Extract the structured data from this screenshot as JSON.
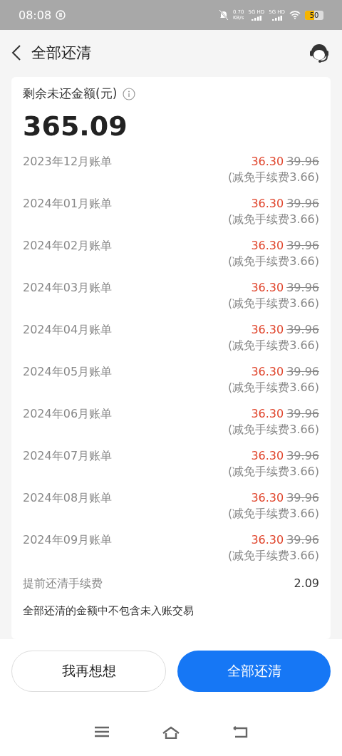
{
  "status_bar": {
    "time": "08:08",
    "speed": "0.70",
    "speed_unit": "KB/s",
    "networks": [
      "5G HD",
      "5G HD"
    ],
    "battery": "50"
  },
  "header": {
    "title": "全部还清"
  },
  "summary": {
    "label": "剩余未还金额(元)",
    "amount": "365.09"
  },
  "bills": [
    {
      "month": "2023年12月账单",
      "amount": "36.30",
      "original": "39.96",
      "note": "(减免手续费3.66)"
    },
    {
      "month": "2024年01月账单",
      "amount": "36.30",
      "original": "39.96",
      "note": "(减免手续费3.66)"
    },
    {
      "month": "2024年02月账单",
      "amount": "36.30",
      "original": "39.96",
      "note": "(减免手续费3.66)"
    },
    {
      "month": "2024年03月账单",
      "amount": "36.30",
      "original": "39.96",
      "note": "(减免手续费3.66)"
    },
    {
      "month": "2024年04月账单",
      "amount": "36.30",
      "original": "39.96",
      "note": "(减免手续费3.66)"
    },
    {
      "month": "2024年05月账单",
      "amount": "36.30",
      "original": "39.96",
      "note": "(减免手续费3.66)"
    },
    {
      "month": "2024年06月账单",
      "amount": "36.30",
      "original": "39.96",
      "note": "(减免手续费3.66)"
    },
    {
      "month": "2024年07月账单",
      "amount": "36.30",
      "original": "39.96",
      "note": "(减免手续费3.66)"
    },
    {
      "month": "2024年08月账单",
      "amount": "36.30",
      "original": "39.96",
      "note": "(减免手续费3.66)"
    },
    {
      "month": "2024年09月账单",
      "amount": "36.30",
      "original": "39.96",
      "note": "(减免手续费3.66)"
    }
  ],
  "fee": {
    "label": "提前还清手续费",
    "value": "2.09"
  },
  "notice": "全部还清的金额中不包含未入账交易",
  "buttons": [
    {
      "label": "我再想想",
      "kind": "secondary"
    },
    {
      "label": "全部还清",
      "kind": "primary"
    }
  ]
}
